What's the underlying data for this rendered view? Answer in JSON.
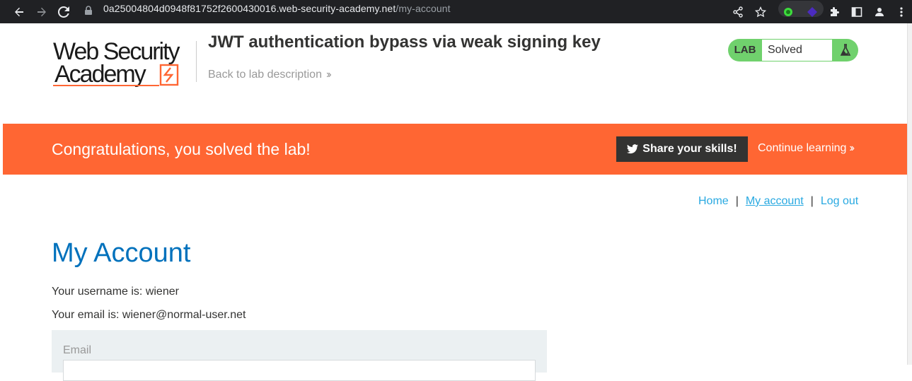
{
  "browser": {
    "url_host": "0a25004804d0948f81752f2600430016.web-security-academy.net",
    "url_path": "/my-account"
  },
  "header": {
    "logo_line1": "Web Security",
    "logo_line2": "Academy",
    "lab_title": "JWT authentication bypass via weak signing key",
    "back_link": "Back to lab description",
    "lab_tag": "LAB",
    "lab_status": "Solved"
  },
  "banner": {
    "message": "Congratulations, you solved the lab!",
    "share_label": "Share your skills!",
    "continue_label": "Continue learning"
  },
  "nav": {
    "home": "Home",
    "separator": "|",
    "my_account": "My account",
    "log_out": "Log out"
  },
  "account": {
    "heading": "My Account",
    "username_line": "Your username is: wiener",
    "email_line": "Your email is: wiener@normal-user.net",
    "email_label": "Email"
  },
  "colors": {
    "banner": "#ff6633",
    "heading": "#0071bc",
    "status_green": "#70d16d"
  }
}
